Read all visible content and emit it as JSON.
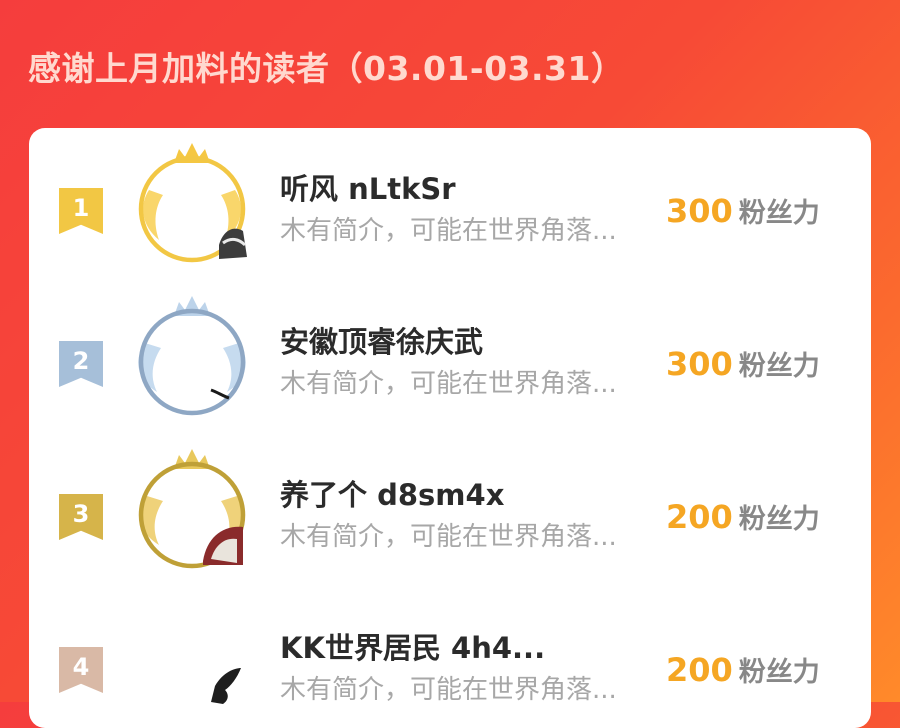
{
  "header": {
    "title": "感谢上月加料的读者（03.01-03.31）"
  },
  "colors": {
    "background_start": "#f53d3d",
    "background_end": "#ff8a2a",
    "score": "#f5a623",
    "rank_1": "#f2c744",
    "rank_2": "#a6bfd9",
    "rank_3": "#d6b44a",
    "rank_4": "#d9b9a6"
  },
  "readers": [
    {
      "rank": "1",
      "name": "听风  nLtkSr",
      "bio": "木有简介，可能在世界角落...",
      "score": "300",
      "unit": "粉丝力",
      "frame": "gold-crown-frame"
    },
    {
      "rank": "2",
      "name": "安徽顶睿徐庆武",
      "bio": "木有简介，可能在世界角落...",
      "score": "300",
      "unit": "粉丝力",
      "frame": "silver-crown-frame"
    },
    {
      "rank": "3",
      "name": "养了个  d8sm4x",
      "bio": "木有简介，可能在世界角落...",
      "score": "200",
      "unit": "粉丝力",
      "frame": "bronze-crown-frame"
    },
    {
      "rank": "4",
      "name": "KK世界居民  4h4...",
      "bio": "木有简介，可能在世界角落...",
      "score": "200",
      "unit": "粉丝力",
      "frame": "none"
    }
  ]
}
